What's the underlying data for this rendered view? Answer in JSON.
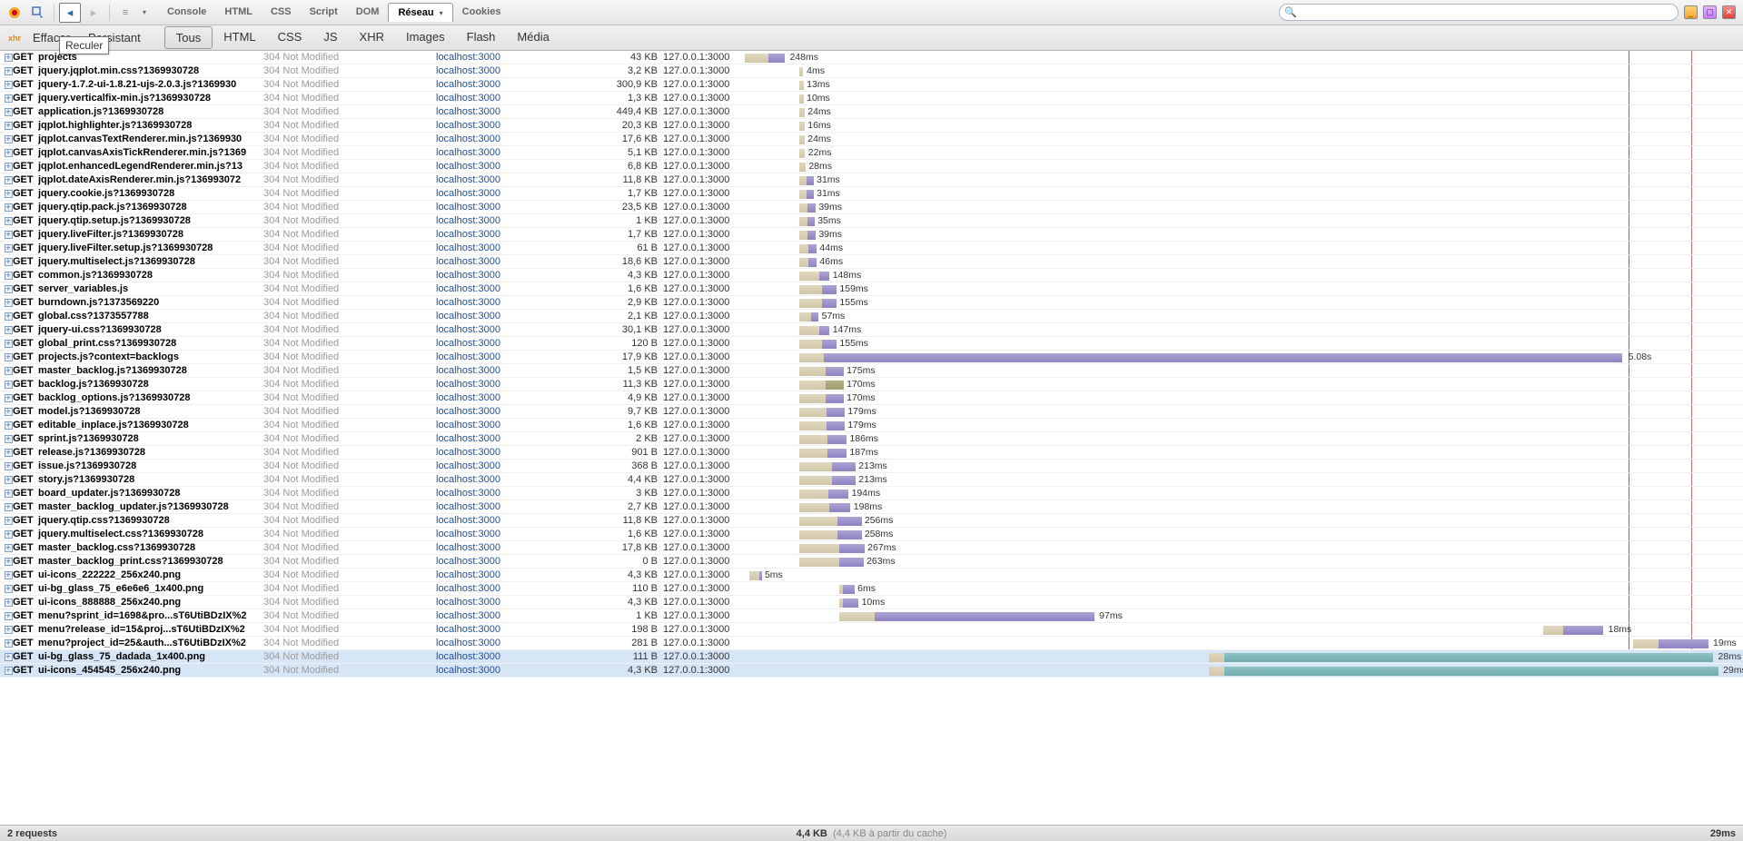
{
  "toolbar": {
    "tabs": [
      {
        "label": "Console",
        "active": false
      },
      {
        "label": "HTML",
        "active": false
      },
      {
        "label": "CSS",
        "active": false
      },
      {
        "label": "Script",
        "active": false
      },
      {
        "label": "DOM",
        "active": false
      },
      {
        "label": "Réseau",
        "active": true,
        "dropdown": true
      },
      {
        "label": "Cookies",
        "active": false
      }
    ]
  },
  "tooltip": "Reculer",
  "netbar": {
    "clear": "Effacer",
    "persist": "Persistant",
    "filters": [
      {
        "label": "Tous",
        "active": true
      },
      {
        "label": "HTML"
      },
      {
        "label": "CSS"
      },
      {
        "label": "JS"
      },
      {
        "label": "XHR"
      },
      {
        "label": "Images"
      },
      {
        "label": "Flash"
      },
      {
        "label": "Média"
      }
    ]
  },
  "status": {
    "requests": "2 requests",
    "size": "4,4 KB",
    "cache": "(4,4 KB à partir du cache)",
    "time": "29ms"
  },
  "timeline": {
    "blue_line_pct": 88.5,
    "red_line_pct": 94.8
  },
  "rows": [
    {
      "m": "GET",
      "u": "projects",
      "s": "304 Not Modified",
      "d": "localhost:3000",
      "sz": "43 KB",
      "ip": "127.0.0.1:3000",
      "wOff": 0,
      "wW": 2.4,
      "rOff": 2.4,
      "rW": 1.6,
      "lbl": "248ms",
      "lblOff": 4.5
    },
    {
      "m": "GET",
      "u": "jquery.jqplot.min.css?1369930728",
      "s": "304 Not Modified",
      "d": "localhost:3000",
      "sz": "3,2 KB",
      "ip": "127.0.0.1:3000",
      "wOff": 5.5,
      "wW": 0.3,
      "lbl": "4ms",
      "lblOff": 6.2
    },
    {
      "m": "GET",
      "u": "jquery-1.7.2-ui-1.8.21-ujs-2.0.3.js?1369930",
      "s": "304 Not Modified",
      "d": "localhost:3000",
      "sz": "300,9 KB",
      "ip": "127.0.0.1:3000",
      "wOff": 5.5,
      "wW": 0.4,
      "lbl": "13ms",
      "lblOff": 6.2
    },
    {
      "m": "GET",
      "u": "jquery.verticalfix-min.js?1369930728",
      "s": "304 Not Modified",
      "d": "localhost:3000",
      "sz": "1,3 KB",
      "ip": "127.0.0.1:3000",
      "wOff": 5.5,
      "wW": 0.4,
      "lbl": "10ms",
      "lblOff": 6.2
    },
    {
      "m": "GET",
      "u": "application.js?1369930728",
      "s": "304 Not Modified",
      "d": "localhost:3000",
      "sz": "449,4 KB",
      "ip": "127.0.0.1:3000",
      "wOff": 5.5,
      "wW": 0.5,
      "lbl": "24ms",
      "lblOff": 6.3
    },
    {
      "m": "GET",
      "u": "jqplot.highlighter.js?1369930728",
      "s": "304 Not Modified",
      "d": "localhost:3000",
      "sz": "20,3 KB",
      "ip": "127.0.0.1:3000",
      "wOff": 5.5,
      "wW": 0.5,
      "lbl": "16ms",
      "lblOff": 6.3
    },
    {
      "m": "GET",
      "u": "jqplot.canvasTextRenderer.min.js?1369930",
      "s": "304 Not Modified",
      "d": "localhost:3000",
      "sz": "17,6 KB",
      "ip": "127.0.0.1:3000",
      "wOff": 5.5,
      "wW": 0.5,
      "lbl": "24ms",
      "lblOff": 6.3
    },
    {
      "m": "GET",
      "u": "jqplot.canvasAxisTickRenderer.min.js?1369",
      "s": "304 Not Modified",
      "d": "localhost:3000",
      "sz": "5,1 KB",
      "ip": "127.0.0.1:3000",
      "wOff": 5.5,
      "wW": 0.55,
      "lbl": "22ms",
      "lblOff": 6.35
    },
    {
      "m": "GET",
      "u": "jqplot.enhancedLegendRenderer.min.js?13",
      "s": "304 Not Modified",
      "d": "localhost:3000",
      "sz": "6,8 KB",
      "ip": "127.0.0.1:3000",
      "wOff": 5.5,
      "wW": 0.6,
      "lbl": "28ms",
      "lblOff": 6.4
    },
    {
      "m": "GET",
      "u": "jqplot.dateAxisRenderer.min.js?136993072",
      "s": "304 Not Modified",
      "d": "localhost:3000",
      "sz": "11,8 KB",
      "ip": "127.0.0.1:3000",
      "wOff": 5.5,
      "wW": 0.7,
      "rOff": 6.2,
      "rW": 0.7,
      "lbl": "31ms",
      "lblOff": 7.2
    },
    {
      "m": "GET",
      "u": "jquery.cookie.js?1369930728",
      "s": "304 Not Modified",
      "d": "localhost:3000",
      "sz": "1,7 KB",
      "ip": "127.0.0.1:3000",
      "wOff": 5.5,
      "wW": 0.7,
      "rOff": 6.2,
      "rW": 0.7,
      "lbl": "31ms",
      "lblOff": 7.2
    },
    {
      "m": "GET",
      "u": "jquery.qtip.pack.js?1369930728",
      "s": "304 Not Modified",
      "d": "localhost:3000",
      "sz": "23,5 KB",
      "ip": "127.0.0.1:3000",
      "wOff": 5.5,
      "wW": 0.8,
      "rOff": 6.3,
      "rW": 0.8,
      "lbl": "39ms",
      "lblOff": 7.4
    },
    {
      "m": "GET",
      "u": "jquery.qtip.setup.js?1369930728",
      "s": "304 Not Modified",
      "d": "localhost:3000",
      "sz": "1 KB",
      "ip": "127.0.0.1:3000",
      "wOff": 5.5,
      "wW": 0.8,
      "rOff": 6.3,
      "rW": 0.7,
      "lbl": "35ms",
      "lblOff": 7.3
    },
    {
      "m": "GET",
      "u": "jquery.liveFilter.js?1369930728",
      "s": "304 Not Modified",
      "d": "localhost:3000",
      "sz": "1,7 KB",
      "ip": "127.0.0.1:3000",
      "wOff": 5.5,
      "wW": 0.8,
      "rOff": 6.3,
      "rW": 0.8,
      "lbl": "39ms",
      "lblOff": 7.4
    },
    {
      "m": "GET",
      "u": "jquery.liveFilter.setup.js?1369930728",
      "s": "304 Not Modified",
      "d": "localhost:3000",
      "sz": "61 B",
      "ip": "127.0.0.1:3000",
      "wOff": 5.5,
      "wW": 0.9,
      "rOff": 6.4,
      "rW": 0.8,
      "lbl": "44ms",
      "lblOff": 7.5
    },
    {
      "m": "GET",
      "u": "jquery.multiselect.js?1369930728",
      "s": "304 Not Modified",
      "d": "localhost:3000",
      "sz": "18,6 KB",
      "ip": "127.0.0.1:3000",
      "wOff": 5.5,
      "wW": 0.9,
      "rOff": 6.4,
      "rW": 0.8,
      "lbl": "46ms",
      "lblOff": 7.5
    },
    {
      "m": "GET",
      "u": "common.js?1369930728",
      "s": "304 Not Modified",
      "d": "localhost:3000",
      "sz": "4,3 KB",
      "ip": "127.0.0.1:3000",
      "wOff": 5.5,
      "wW": 2.0,
      "rOff": 7.5,
      "rW": 1.0,
      "lbl": "148ms",
      "lblOff": 8.8
    },
    {
      "m": "GET",
      "u": "server_variables.js",
      "s": "304 Not Modified",
      "d": "localhost:3000",
      "sz": "1,6 KB",
      "ip": "127.0.0.1:3000",
      "wOff": 5.5,
      "wW": 2.2,
      "rOff": 7.7,
      "rW": 1.5,
      "lbl": "159ms",
      "lblOff": 9.5
    },
    {
      "m": "GET",
      "u": "burndown.js?1373569220",
      "s": "304 Not Modified",
      "d": "localhost:3000",
      "sz": "2,9 KB",
      "ip": "127.0.0.1:3000",
      "wOff": 5.5,
      "wW": 2.2,
      "rOff": 7.7,
      "rW": 1.5,
      "lbl": "155ms",
      "lblOff": 9.5
    },
    {
      "m": "GET",
      "u": "global.css?1373557788",
      "s": "304 Not Modified",
      "d": "localhost:3000",
      "sz": "2,1 KB",
      "ip": "127.0.0.1:3000",
      "wOff": 5.5,
      "wW": 1.1,
      "rOff": 6.6,
      "rW": 0.8,
      "lbl": "57ms",
      "lblOff": 7.7
    },
    {
      "m": "GET",
      "u": "jquery-ui.css?1369930728",
      "s": "304 Not Modified",
      "d": "localhost:3000",
      "sz": "30,1 KB",
      "ip": "127.0.0.1:3000",
      "wOff": 5.5,
      "wW": 2.0,
      "rOff": 7.5,
      "rW": 1.0,
      "lbl": "147ms",
      "lblOff": 8.8
    },
    {
      "m": "GET",
      "u": "global_print.css?1369930728",
      "s": "304 Not Modified",
      "d": "localhost:3000",
      "sz": "120 B",
      "ip": "127.0.0.1:3000",
      "wOff": 5.5,
      "wW": 2.2,
      "rOff": 7.7,
      "rW": 1.5,
      "lbl": "155ms",
      "lblOff": 9.5
    },
    {
      "m": "GET",
      "u": "projects.js?context=backlogs",
      "s": "304 Not Modified",
      "d": "localhost:3000",
      "sz": "17,9 KB",
      "ip": "127.0.0.1:3000",
      "wOff": 5.5,
      "wW": 2.4,
      "rOff": 7.9,
      "rW": 80,
      "lbl": "5.08s",
      "lblOff": 88.5
    },
    {
      "m": "GET",
      "u": "master_backlog.js?1369930728",
      "s": "304 Not Modified",
      "d": "localhost:3000",
      "sz": "1,5 KB",
      "ip": "127.0.0.1:3000",
      "wOff": 5.5,
      "wW": 2.6,
      "rOff": 8.1,
      "rW": 1.8,
      "lbl": "175ms",
      "lblOff": 10.2
    },
    {
      "m": "GET",
      "u": "backlog.js?1369930728",
      "s": "304 Not Modified",
      "d": "localhost:3000",
      "sz": "11,3 KB",
      "ip": "127.0.0.1:3000",
      "wOff": 5.5,
      "wW": 2.6,
      "rOff": 8.1,
      "rW": 1.8,
      "r2": true,
      "lbl": "170ms",
      "lblOff": 10.2
    },
    {
      "m": "GET",
      "u": "backlog_options.js?1369930728",
      "s": "304 Not Modified",
      "d": "localhost:3000",
      "sz": "4,9 KB",
      "ip": "127.0.0.1:3000",
      "wOff": 5.5,
      "wW": 2.6,
      "rOff": 8.1,
      "rW": 1.8,
      "lbl": "170ms",
      "lblOff": 10.2
    },
    {
      "m": "GET",
      "u": "model.js?1369930728",
      "s": "304 Not Modified",
      "d": "localhost:3000",
      "sz": "9,7 KB",
      "ip": "127.0.0.1:3000",
      "wOff": 5.5,
      "wW": 2.7,
      "rOff": 8.2,
      "rW": 1.8,
      "lbl": "179ms",
      "lblOff": 10.3
    },
    {
      "m": "GET",
      "u": "editable_inplace.js?1369930728",
      "s": "304 Not Modified",
      "d": "localhost:3000",
      "sz": "1,6 KB",
      "ip": "127.0.0.1:3000",
      "wOff": 5.5,
      "wW": 2.7,
      "rOff": 8.2,
      "rW": 1.8,
      "lbl": "179ms",
      "lblOff": 10.3
    },
    {
      "m": "GET",
      "u": "sprint.js?1369930728",
      "s": "304 Not Modified",
      "d": "localhost:3000",
      "sz": "2 KB",
      "ip": "127.0.0.1:3000",
      "wOff": 5.5,
      "wW": 2.8,
      "rOff": 8.3,
      "rW": 1.9,
      "lbl": "186ms",
      "lblOff": 10.5
    },
    {
      "m": "GET",
      "u": "release.js?1369930728",
      "s": "304 Not Modified",
      "d": "localhost:3000",
      "sz": "901 B",
      "ip": "127.0.0.1:3000",
      "wOff": 5.5,
      "wW": 2.8,
      "rOff": 8.3,
      "rW": 1.9,
      "lbl": "187ms",
      "lblOff": 10.5
    },
    {
      "m": "GET",
      "u": "issue.js?1369930728",
      "s": "304 Not Modified",
      "d": "localhost:3000",
      "sz": "368 B",
      "ip": "127.0.0.1:3000",
      "wOff": 5.5,
      "wW": 3.2,
      "rOff": 8.7,
      "rW": 2.4,
      "lbl": "213ms",
      "lblOff": 11.4
    },
    {
      "m": "GET",
      "u": "story.js?1369930728",
      "s": "304 Not Modified",
      "d": "localhost:3000",
      "sz": "4,4 KB",
      "ip": "127.0.0.1:3000",
      "wOff": 5.5,
      "wW": 3.2,
      "rOff": 8.7,
      "rW": 2.4,
      "lbl": "213ms",
      "lblOff": 11.4
    },
    {
      "m": "GET",
      "u": "board_updater.js?1369930728",
      "s": "304 Not Modified",
      "d": "localhost:3000",
      "sz": "3 KB",
      "ip": "127.0.0.1:3000",
      "wOff": 5.5,
      "wW": 2.9,
      "rOff": 8.4,
      "rW": 2.0,
      "lbl": "194ms",
      "lblOff": 10.7
    },
    {
      "m": "GET",
      "u": "master_backlog_updater.js?1369930728",
      "s": "304 Not Modified",
      "d": "localhost:3000",
      "sz": "2,7 KB",
      "ip": "127.0.0.1:3000",
      "wOff": 5.5,
      "wW": 3.0,
      "rOff": 8.5,
      "rW": 2.1,
      "lbl": "198ms",
      "lblOff": 10.9
    },
    {
      "m": "GET",
      "u": "jquery.qtip.css?1369930728",
      "s": "304 Not Modified",
      "d": "localhost:3000",
      "sz": "11,8 KB",
      "ip": "127.0.0.1:3000",
      "wOff": 5.5,
      "wW": 3.8,
      "rOff": 9.3,
      "rW": 2.4,
      "lbl": "256ms",
      "lblOff": 12.0
    },
    {
      "m": "GET",
      "u": "jquery.multiselect.css?1369930728",
      "s": "304 Not Modified",
      "d": "localhost:3000",
      "sz": "1,6 KB",
      "ip": "127.0.0.1:3000",
      "wOff": 5.5,
      "wW": 3.8,
      "rOff": 9.3,
      "rW": 2.4,
      "lbl": "258ms",
      "lblOff": 12.0
    },
    {
      "m": "GET",
      "u": "master_backlog.css?1369930728",
      "s": "304 Not Modified",
      "d": "localhost:3000",
      "sz": "17,8 KB",
      "ip": "127.0.0.1:3000",
      "wOff": 5.5,
      "wW": 4.0,
      "rOff": 9.5,
      "rW": 2.5,
      "lbl": "267ms",
      "lblOff": 12.3
    },
    {
      "m": "GET",
      "u": "master_backlog_print.css?1369930728",
      "s": "304 Not Modified",
      "d": "localhost:3000",
      "sz": "0 B",
      "ip": "127.0.0.1:3000",
      "wOff": 5.5,
      "wW": 4.0,
      "rOff": 9.5,
      "rW": 2.4,
      "lbl": "263ms",
      "lblOff": 12.2
    },
    {
      "m": "GET",
      "u": "ui-icons_222222_256x240.png",
      "s": "304 Not Modified",
      "d": "localhost:3000",
      "sz": "4,3 KB",
      "ip": "127.0.0.1:3000",
      "wOff": 0.5,
      "wW": 1.0,
      "rOff": 1.5,
      "rW": 0.2,
      "lbl": "5ms",
      "lblOff": 2.0
    },
    {
      "m": "GET",
      "u": "ui-bg_glass_75_e6e6e6_1x400.png",
      "s": "304 Not Modified",
      "d": "localhost:3000",
      "sz": "110 B",
      "ip": "127.0.0.1:3000",
      "wOff": 9.5,
      "wW": 0.3,
      "rOff": 9.8,
      "rW": 1.2,
      "lbl": "6ms",
      "lblOff": 11.3
    },
    {
      "m": "GET",
      "u": "ui-icons_888888_256x240.png",
      "s": "304 Not Modified",
      "d": "localhost:3000",
      "sz": "4,3 KB",
      "ip": "127.0.0.1:3000",
      "wOff": 9.5,
      "wW": 0.3,
      "rOff": 9.8,
      "rW": 1.6,
      "lbl": "10ms",
      "lblOff": 11.7
    },
    {
      "m": "GET",
      "u": "menu?sprint_id=1698&pro...sT6UtiBDzIX%2",
      "s": "304 Not Modified",
      "d": "localhost:3000",
      "sz": "1 KB",
      "ip": "127.0.0.1:3000",
      "wOff": 9.5,
      "wW": 3.5,
      "rOff": 13,
      "rW": 22,
      "lbl": "97ms",
      "lblOff": 35.5
    },
    {
      "m": "GET",
      "u": "menu?release_id=15&proj...sT6UtiBDzIX%2",
      "s": "304 Not Modified",
      "d": "localhost:3000",
      "sz": "198 B",
      "ip": "127.0.0.1:3000",
      "wOff": 80,
      "wW": 2,
      "rOff": 82,
      "rW": 4,
      "lbl": "18ms",
      "lblOff": 86.5
    },
    {
      "m": "GET",
      "u": "menu?project_id=25&auth...sT6UtiBDzIX%2",
      "s": "304 Not Modified",
      "d": "localhost:3000",
      "sz": "281 B",
      "ip": "127.0.0.1:3000",
      "wOff": 89,
      "wW": 2.5,
      "rOff": 91.5,
      "rW": 5,
      "lbl": "19ms",
      "lblOff": 97
    },
    {
      "m": "GET",
      "u": "ui-bg_glass_75_dadada_1x400.png",
      "s": "304 Not Modified",
      "d": "localhost:3000",
      "sz": "111 B",
      "ip": "127.0.0.1:3000",
      "wOff": 46.5,
      "wW": 1.5,
      "rOff": 48,
      "rW": 49,
      "r3": true,
      "lbl": "28ms",
      "lblOff": 97.5,
      "sel": true
    },
    {
      "m": "GET",
      "u": "ui-icons_454545_256x240.png",
      "s": "304 Not Modified",
      "d": "localhost:3000",
      "sz": "4,3 KB",
      "ip": "127.0.0.1:3000",
      "wOff": 46.5,
      "wW": 1.5,
      "rOff": 48,
      "rW": 49.5,
      "r3": true,
      "lbl": "29ms",
      "lblOff": 98,
      "sel": true
    }
  ]
}
